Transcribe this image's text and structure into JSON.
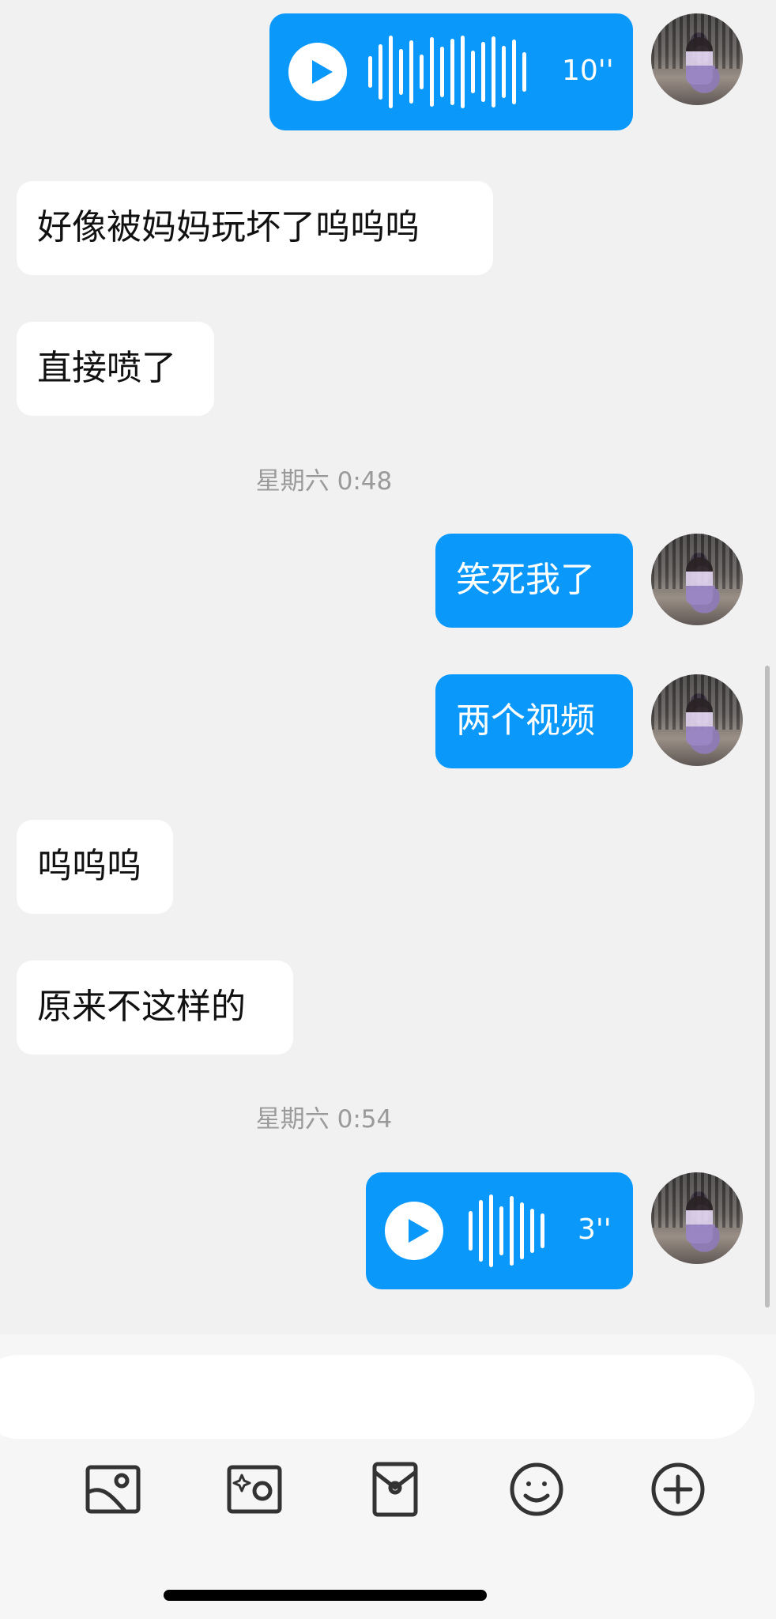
{
  "messages": {
    "voice1": {
      "duration": "10''"
    },
    "in1": "好像被妈妈玩坏了呜呜呜",
    "in2": "直接喷了",
    "time1": "星期六 0:48",
    "out1": "笑死我了",
    "out2": "两个视频",
    "in3": "呜呜呜",
    "in4": "原来不这样的",
    "time2": "星期六 0:54",
    "voice2": {
      "duration": "3''"
    }
  },
  "input": {
    "value": "",
    "placeholder": ""
  },
  "toolbar": {
    "icons": [
      "image-icon",
      "camera-icon",
      "red-packet-icon",
      "emoji-icon",
      "plus-icon"
    ]
  },
  "colors": {
    "outgoing_bubble": "#0a98fb",
    "incoming_bubble": "#ffffff",
    "background": "#f1f1f2",
    "timestamp": "#9a9a9a"
  }
}
